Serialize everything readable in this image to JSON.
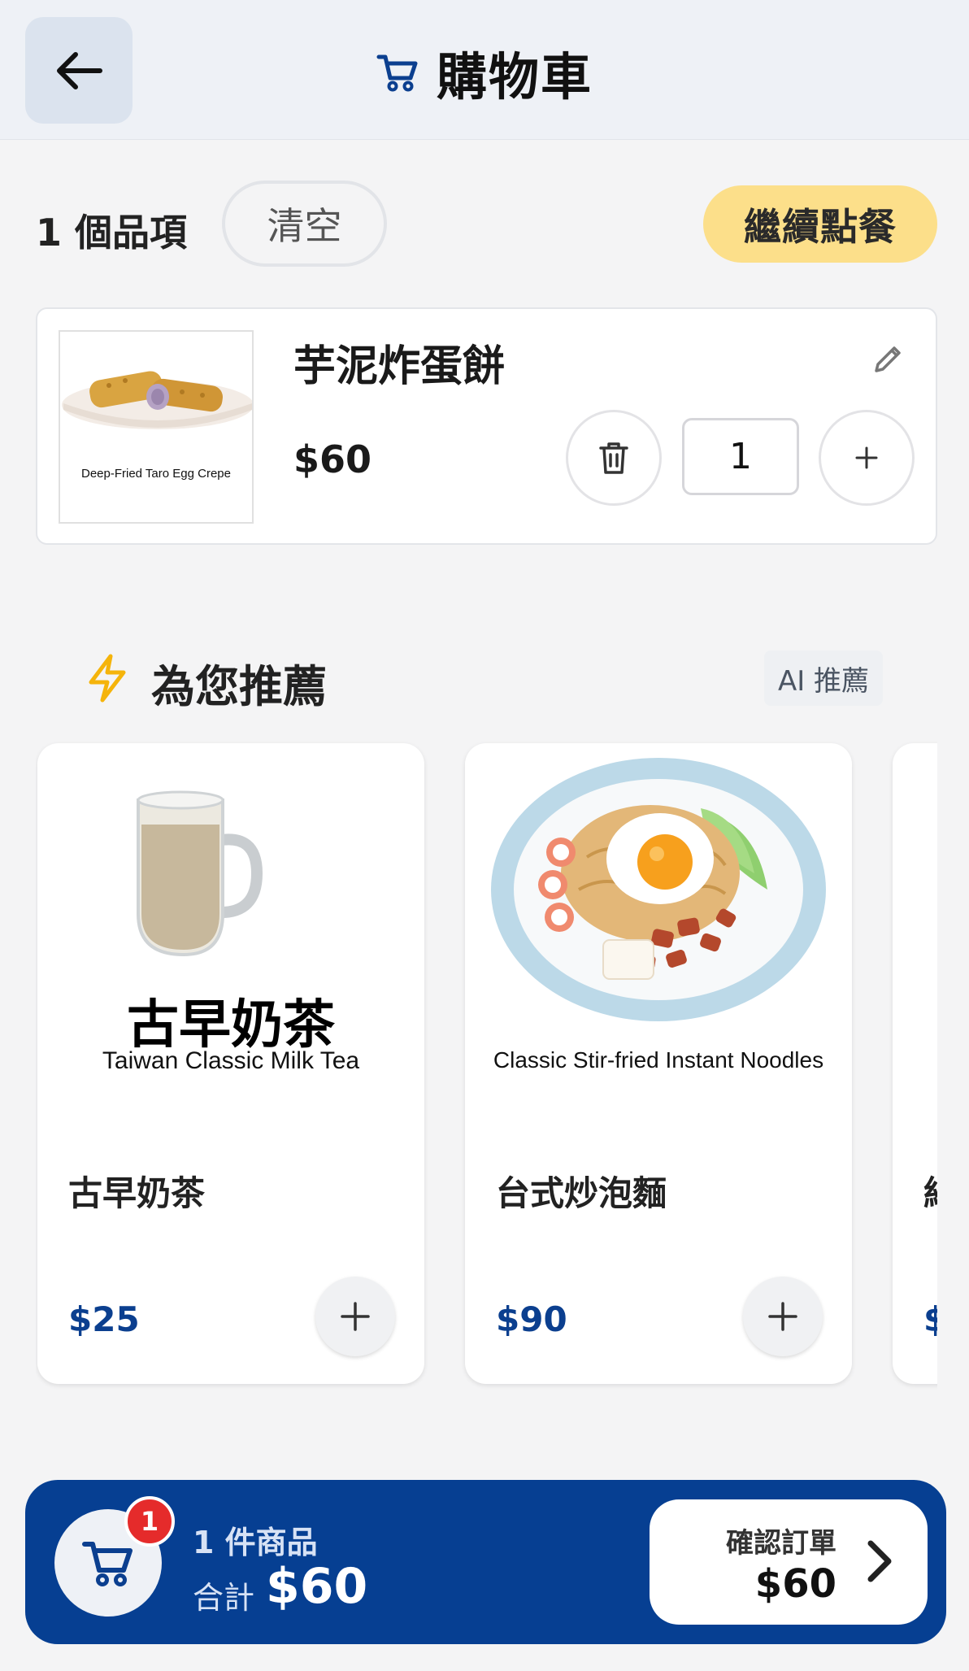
{
  "header": {
    "title": "購物車",
    "back_icon": "arrow-left-icon",
    "cart_icon": "cart-icon"
  },
  "toolbar": {
    "item_count": "1 個品項",
    "clear_label": "清空",
    "continue_label": "繼續點餐"
  },
  "cart": {
    "items": [
      {
        "name": "芋泥炸蛋餅",
        "price": "$60",
        "quantity": "1",
        "image_caption": "Deep-Fried Taro Egg Crepe"
      }
    ]
  },
  "recommendations": {
    "title": "為您推薦",
    "badge": "AI 推薦",
    "items": [
      {
        "name": "古早奶茶",
        "price": "$25",
        "image_label_zh": "古早奶茶",
        "image_label_en": "Taiwan Classic Milk Tea"
      },
      {
        "name": "台式炒泡麵",
        "price": "$90",
        "image_label_en": "Classic Stir-fried Instant Noodles"
      },
      {
        "name": "紹",
        "price": "$"
      }
    ]
  },
  "bottom_bar": {
    "badge_count": "1",
    "summary_count": "1 件商品",
    "total_label": "合計",
    "total_value": "$60",
    "confirm_label": "確認訂單",
    "confirm_price": "$60"
  },
  "colors": {
    "brand_blue": "#063f92",
    "accent_yellow": "#fcdf8a",
    "badge_red": "#e52b2b",
    "price_blue": "#0b3f8f",
    "lightning_yellow": "#f5b40b"
  }
}
